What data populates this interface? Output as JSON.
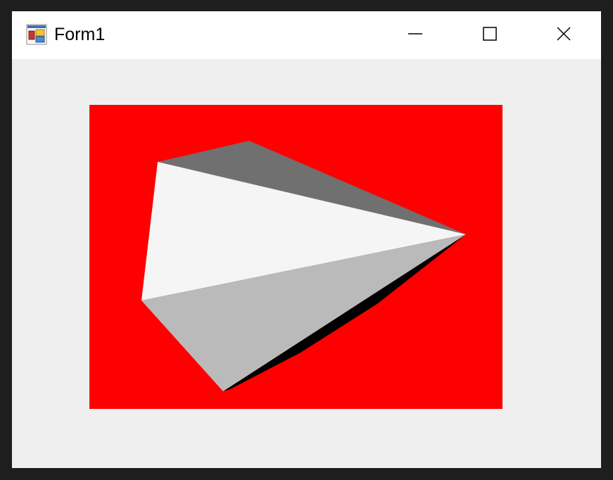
{
  "window": {
    "title": "Form1",
    "icon": "winforms-app-icon"
  },
  "caption_buttons": {
    "minimize": "minimize-icon",
    "maximize": "maximize-icon",
    "close": "close-icon"
  },
  "render": {
    "background_color": "#ff0000",
    "faces": [
      {
        "color": "#707070"
      },
      {
        "color": "#f5f5f5"
      },
      {
        "color": "#bababa"
      },
      {
        "color": "#000000"
      }
    ]
  }
}
